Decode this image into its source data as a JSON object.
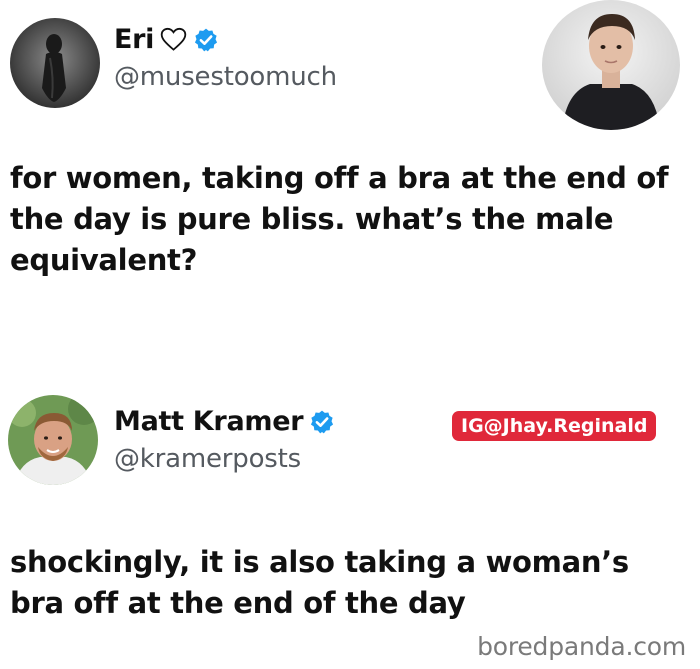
{
  "tweets": [
    {
      "display_name": "Eri",
      "handle": "@musestoomuch",
      "text": "for women, taking off a bra at the end of the day is pure bliss. what’s the male equivalent?",
      "icons": [
        "avatar",
        "heart-outline-icon",
        "verified-badge-icon"
      ]
    },
    {
      "display_name": "Matt Kramer",
      "handle": "@kramerposts",
      "text": "shockingly, it is also taking a woman’s bra off at the end of the day",
      "icons": [
        "avatar",
        "verified-badge-icon"
      ]
    }
  ],
  "watermark": "IG@Jhay.Reginald",
  "source": "boredpanda.com",
  "colors": {
    "verified": "#1d9bf0",
    "watermark_bg": "#e0283a",
    "handle": "#555a60",
    "text": "#111111"
  }
}
